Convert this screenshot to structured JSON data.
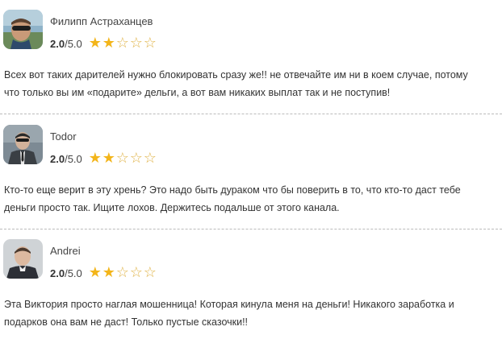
{
  "reviews": [
    {
      "author": "Филипп Астраханцев",
      "score": "2.0",
      "score_max": "/5.0",
      "rating_value": 2,
      "rating_scale": 5,
      "text_line1": "Всех вот таких дарителей нужно блокировать сразу же!! не отвечайте им ни в коем случае, потому",
      "text_line2": "что только вы им «подарите» дельги, а вот вам никаких выплат так и не поступив!"
    },
    {
      "author": "Todor",
      "score": "2.0",
      "score_max": "/5.0",
      "rating_value": 2,
      "rating_scale": 5,
      "text_line1": "Кто-то еще верит в эту хрень? Это надо быть дураком что бы поверить в то, что кто-то даст тебе",
      "text_line2": "деньги просто так. Ищите лохов. Держитесь подальше от этого канала."
    },
    {
      "author": "Andrei",
      "score": "2.0",
      "score_max": "/5.0",
      "rating_value": 2,
      "rating_scale": 5,
      "text_line1": "Эта Виктория просто наглая мошенница! Которая кинула меня на деньги! Никакого заработка и",
      "text_line2": "подарков она вам не даст! Только пустые сказочки!!"
    }
  ],
  "colors": {
    "star_filled": "#f3b51a",
    "star_empty": "#e0b44a",
    "divider": "#bbbbbb"
  }
}
